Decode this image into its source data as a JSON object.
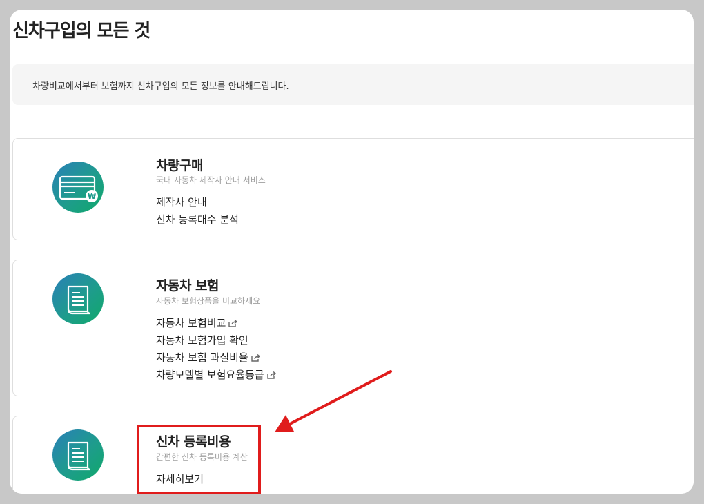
{
  "page": {
    "title": "신차구입의 모든 것",
    "notice": "차량비교에서부터 보험까지 신차구입의 모든 정보를 안내해드립니다."
  },
  "cards": [
    {
      "title": "차량구매",
      "subtitle": "국내 자동차 제작자 안내 서비스",
      "icon": "credit-card-icon",
      "links": [
        {
          "label": "제작사 안내",
          "external": false
        },
        {
          "label": "신차 등록대수 분석",
          "external": false
        }
      ]
    },
    {
      "title": "자동차 보험",
      "subtitle": "자동차 보험상품을 비교하세요",
      "icon": "document-icon",
      "links": [
        {
          "label": "자동차 보험비교",
          "external": true
        },
        {
          "label": "자동차 보험가입 확인",
          "external": false
        },
        {
          "label": "자동차 보험 과실비율",
          "external": true
        },
        {
          "label": "차량모델별 보험요율등급",
          "external": true
        }
      ]
    },
    {
      "title": "신차 등록비용",
      "subtitle": "간편한 신차 등록비용 계산",
      "icon": "document-icon",
      "links": [
        {
          "label": "자세히보기",
          "external": false
        }
      ]
    }
  ],
  "colors": {
    "icon_gradient_start": "#2a7fb8",
    "icon_gradient_end": "#10a86a",
    "annotation": "#e01c1c"
  }
}
